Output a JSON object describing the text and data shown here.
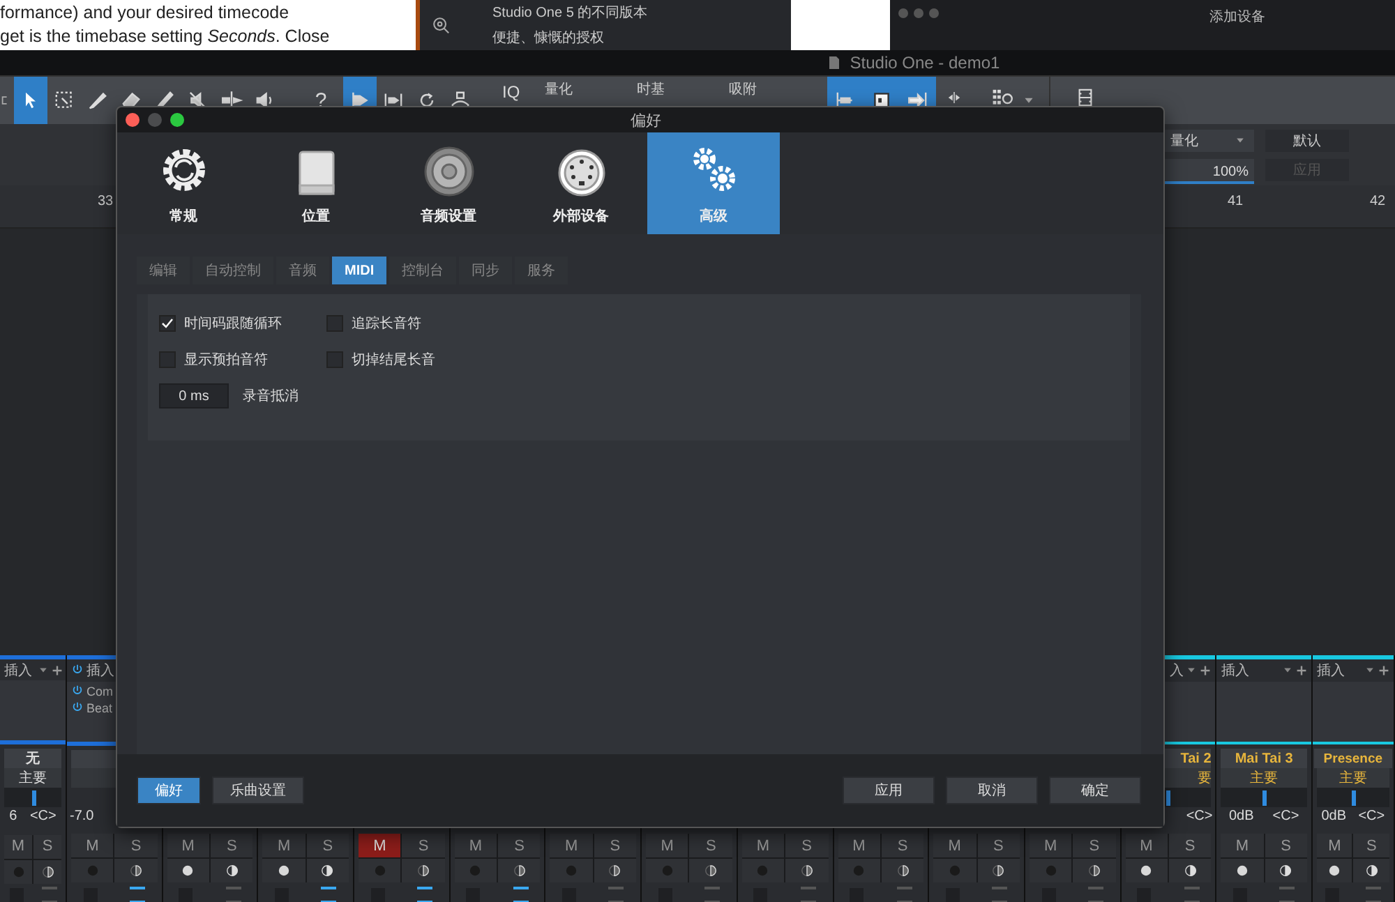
{
  "document": {
    "lines": [
      "formance) and your desired timecode",
      "get is the timebase setting *Seconds*. Close"
    ]
  },
  "banner": {
    "lines": [
      "Studio One 5 的不同版本",
      "便捷、慷慨的授权"
    ]
  },
  "add_device_window": {
    "title": "添加设备"
  },
  "app": {
    "title": "Studio One - demo1"
  },
  "toolbar": {
    "tools": [
      {
        "kind": "arrow",
        "selected": true
      },
      {
        "kind": "marquee",
        "selected": false
      },
      {
        "kind": "knife",
        "selected": false
      },
      {
        "kind": "eraser",
        "selected": false
      },
      {
        "kind": "brush",
        "selected": false
      },
      {
        "kind": "mute",
        "selected": false
      },
      {
        "kind": "split",
        "selected": false
      },
      {
        "kind": "speaker",
        "selected": false
      }
    ],
    "help": "?",
    "modes": [
      {
        "kind": "follow",
        "selected": true
      },
      {
        "kind": "bend",
        "selected": false
      },
      {
        "kind": "loop",
        "selected": false
      },
      {
        "kind": "metronome",
        "selected": false
      }
    ],
    "iq": "IQ",
    "labels": [
      "量化",
      "时基",
      "吸附"
    ],
    "nudge": [
      {
        "kind": "left",
        "selected": true
      },
      {
        "kind": "center",
        "selected": true
      },
      {
        "kind": "right",
        "selected": true
      }
    ]
  },
  "quantize_panel": {
    "quantize": "量化",
    "default": "默认",
    "percent": "100%",
    "level": 1,
    "apply": "应用",
    "apply_disabled": true
  },
  "ruler": {
    "marks": [
      "33",
      "41",
      "42"
    ]
  },
  "dialog": {
    "title": "偏好",
    "categories": [
      {
        "label": "常规",
        "kind": "general",
        "selected": false
      },
      {
        "label": "位置",
        "kind": "location",
        "selected": false
      },
      {
        "label": "音频设置",
        "kind": "audio",
        "selected": false
      },
      {
        "label": "外部设备",
        "kind": "external",
        "selected": false
      },
      {
        "label": "高级",
        "kind": "advanced",
        "selected": true
      }
    ],
    "tabs": [
      {
        "label": "编辑",
        "selected": false
      },
      {
        "label": "自动控制",
        "selected": false
      },
      {
        "label": "音频",
        "selected": false
      },
      {
        "label": "MIDI",
        "selected": true
      },
      {
        "label": "控制台",
        "selected": false
      },
      {
        "label": "同步",
        "selected": false
      },
      {
        "label": "服务",
        "selected": false
      }
    ],
    "options": [
      {
        "label": "时间码跟随循环",
        "checked": true
      },
      {
        "label": "追踪长音符",
        "checked": false
      },
      {
        "label": "显示预拍音符",
        "checked": false
      },
      {
        "label": "切掉结尾长音",
        "checked": false
      }
    ],
    "offset": {
      "value": "0 ms",
      "label": "录音抵消"
    },
    "footer_left": [
      {
        "label": "偏好",
        "selected": true
      },
      {
        "label": "乐曲设置",
        "selected": false
      }
    ],
    "footer_right": [
      "应用",
      "取消",
      "确定"
    ]
  },
  "mixer": {
    "channels": [
      {
        "kind": "audio",
        "color": "#1e6fd9",
        "insert": "插入",
        "name": "无",
        "bus": "主要",
        "level": 0.5,
        "volume": "6",
        "pan": "<C>",
        "mute_label": "M",
        "solo_label": "S",
        "muted": false,
        "armed": false,
        "output_active": false
      },
      {
        "kind": "audio",
        "color": "#1e6fd9",
        "insert": "插入",
        "plugins": [
          "Com",
          "Beat"
        ],
        "volume": "-7.0",
        "mute_label": "M",
        "solo_label": "S",
        "muted": false,
        "armed": false,
        "output_active": true
      },
      {
        "mute_label": "M",
        "solo_label": "S",
        "muted": false,
        "armed": true,
        "output_active": false
      },
      {
        "mute_label": "M",
        "solo_label": "S",
        "muted": false,
        "armed": true,
        "output_active": true
      },
      {
        "mute_label": "M",
        "solo_label": "S",
        "muted": true,
        "armed": false,
        "output_active": true
      },
      {
        "mute_label": "M",
        "solo_label": "S",
        "muted": false,
        "armed": false,
        "output_active": true
      },
      {
        "mute_label": "M",
        "solo_label": "S",
        "muted": false,
        "armed": false,
        "output_active": false
      },
      {
        "mute_label": "M",
        "solo_label": "S",
        "muted": false,
        "armed": false,
        "output_active": false
      },
      {
        "mute_label": "M",
        "solo_label": "S",
        "muted": false,
        "armed": false,
        "output_active": false
      },
      {
        "mute_label": "M",
        "solo_label": "S",
        "muted": false,
        "armed": false,
        "output_active": false
      },
      {
        "mute_label": "M",
        "solo_label": "S",
        "muted": false,
        "armed": false,
        "output_active": false
      },
      {
        "mute_label": "M",
        "solo_label": "S",
        "muted": false,
        "armed": false,
        "output_active": false
      },
      {
        "kind": "instrument",
        "color": "#18c8e0",
        "insert": "入",
        "name": "Tai 2",
        "bus": "要",
        "level": 0.5,
        "pan": "<C>",
        "mute_label": "M",
        "solo_label": "S",
        "muted": false,
        "armed": true,
        "output_active": false
      },
      {
        "kind": "instrument",
        "color": "#18c8e0",
        "insert": "插入",
        "name": "Mai Tai 3",
        "bus": "主要",
        "level": 0.5,
        "volume": "0dB",
        "pan": "<C>",
        "mute_label": "M",
        "solo_label": "S",
        "muted": false,
        "armed": true,
        "output_active": false
      },
      {
        "kind": "instrument",
        "color": "#18c8e0",
        "insert": "插入",
        "name": "Presence",
        "bus": "主要",
        "level": 0.5,
        "volume": "0dB",
        "pan": "<C>",
        "mute_label": "M",
        "solo_label": "S",
        "muted": false,
        "armed": true,
        "output_active": false
      }
    ]
  }
}
